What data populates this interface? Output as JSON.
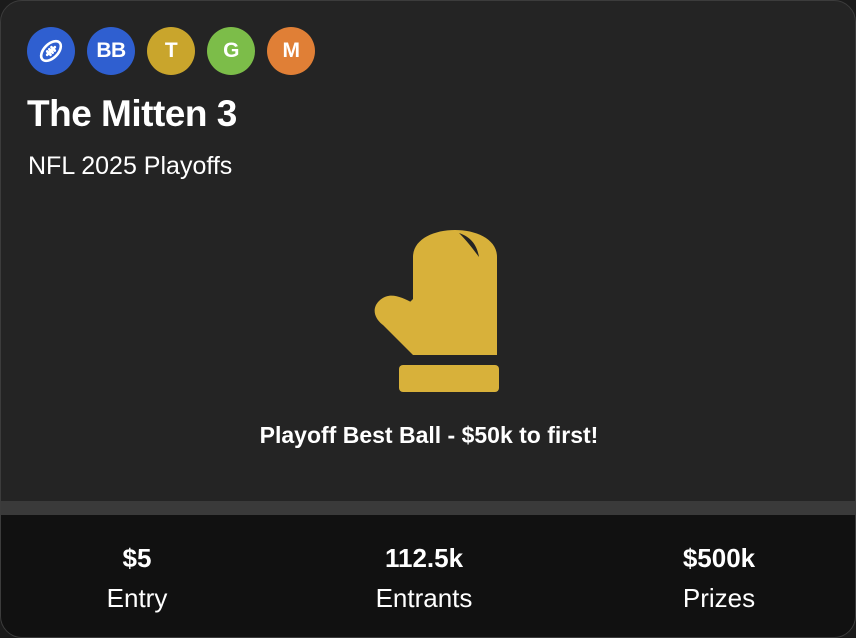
{
  "badges": [
    {
      "icon": "football-icon",
      "text": "",
      "color": "#2f5fd0"
    },
    {
      "icon": "",
      "text": "BB",
      "color": "#2f5fd0"
    },
    {
      "icon": "",
      "text": "T",
      "color": "#c9a52c"
    },
    {
      "icon": "",
      "text": "G",
      "color": "#7cbd49"
    },
    {
      "icon": "",
      "text": "M",
      "color": "#e07f36"
    }
  ],
  "contest": {
    "title": "The Mitten 3",
    "subtitle": "NFL 2025 Playoffs",
    "hero_icon": "mitten-icon",
    "hero_color": "#d8b13a",
    "tagline": "Playoff Best Ball - $50k to first!"
  },
  "stats": {
    "entry": {
      "value": "$5",
      "label": "Entry"
    },
    "entrants": {
      "value": "112.5k",
      "label": "Entrants"
    },
    "prizes": {
      "value": "$500k",
      "label": "Prizes"
    }
  }
}
